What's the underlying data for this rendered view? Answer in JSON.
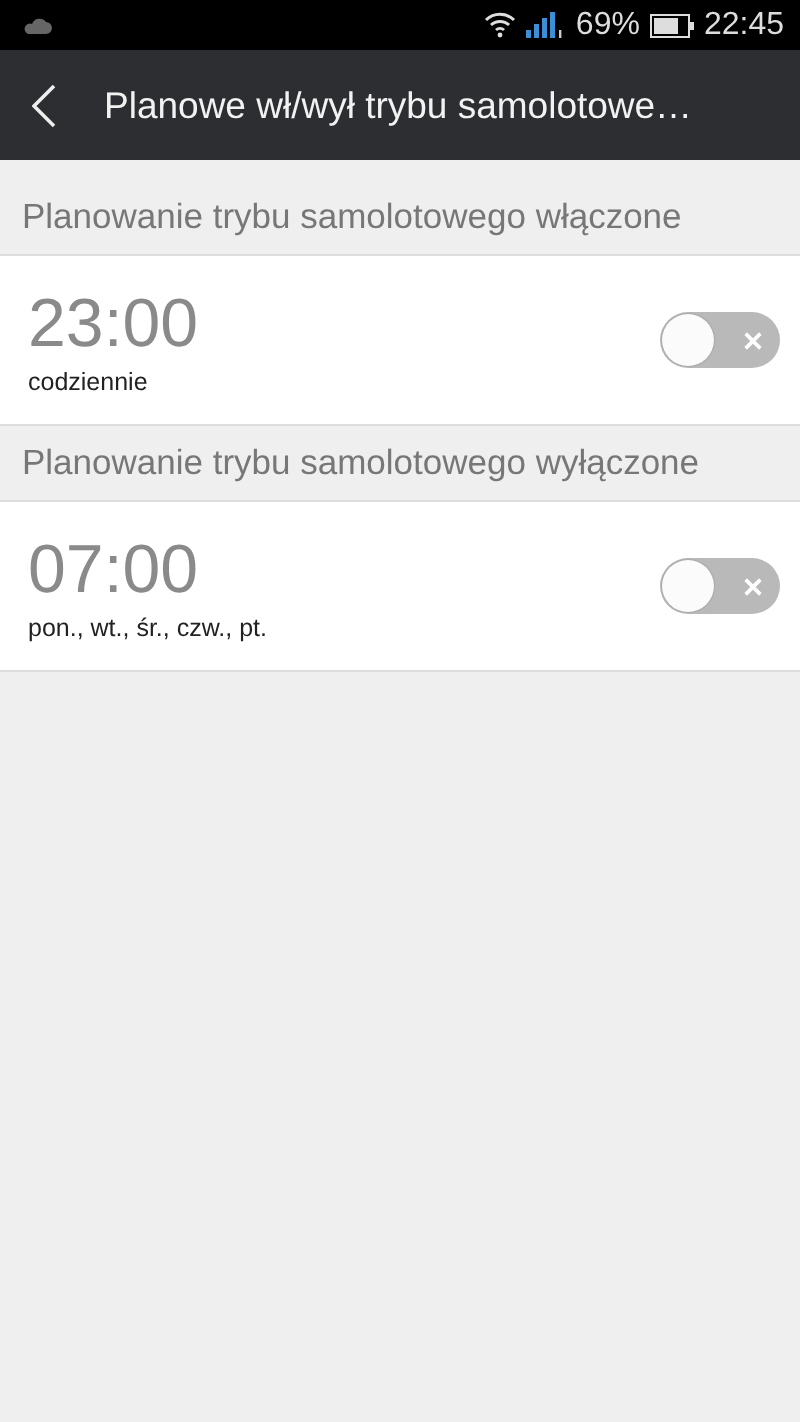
{
  "status_bar": {
    "battery_text": "69%",
    "time": "22:45"
  },
  "header": {
    "title": "Planowe wł/wył trybu samolotowe…"
  },
  "sections": [
    {
      "heading": "Planowanie trybu samolotowego włączone",
      "time": "23:00",
      "repeat": "codziennie",
      "on": false
    },
    {
      "heading": "Planowanie trybu samolotowego wyłączone",
      "time": "07:00",
      "repeat": "pon., wt., śr., czw., pt.",
      "on": false
    }
  ]
}
